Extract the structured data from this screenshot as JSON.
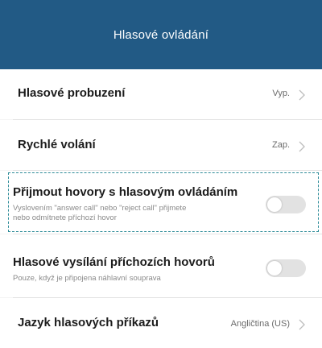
{
  "header": {
    "title": "Hlasové ovládání"
  },
  "items": [
    {
      "label": "Hlasové probuzení",
      "value": "Vyp."
    },
    {
      "label": "Rychlé volání",
      "value": "Zap."
    },
    {
      "label": "Přijmout hovory s hlasovým ovládáním",
      "sub_line1": "Vyslovením \"answer call\" nebo \"reject call\" přijmete",
      "sub_line2": "nebo odmítnete příchozí hovor",
      "toggle": "off"
    },
    {
      "label": "Hlasové vysílání příchozích hovorů",
      "sub_line1": "Pouze, když je připojena náhlavní souprava",
      "toggle": "off"
    },
    {
      "label": "Jazyk hlasových příkazů",
      "value": "Angličtina (US)"
    }
  ],
  "colors": {
    "header_bg": "#225a85",
    "highlight": "#2d8b98",
    "toggle_off": "#e2e2e2"
  }
}
